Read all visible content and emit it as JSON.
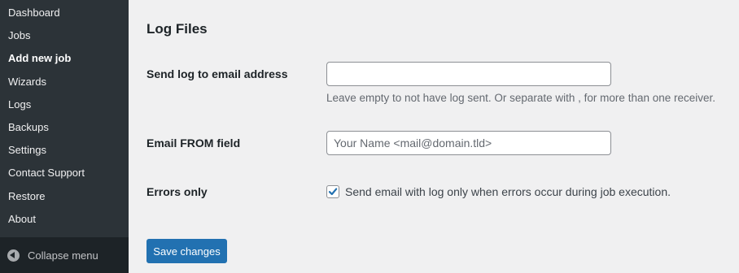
{
  "sidebar": {
    "items": [
      {
        "label": "Dashboard"
      },
      {
        "label": "Jobs"
      },
      {
        "label": "Add new job"
      },
      {
        "label": "Wizards"
      },
      {
        "label": "Logs"
      },
      {
        "label": "Backups"
      },
      {
        "label": "Settings"
      },
      {
        "label": "Contact Support"
      },
      {
        "label": "Restore"
      },
      {
        "label": "About"
      }
    ],
    "current": "Add new job",
    "collapse_label": "Collapse menu"
  },
  "section": {
    "title": "Log Files"
  },
  "fields": {
    "send_log": {
      "label": "Send log to email address",
      "value": "",
      "placeholder": "",
      "description": "Leave empty to not have log sent. Or separate with , for more than one receiver."
    },
    "email_from": {
      "label": "Email FROM field",
      "value": "",
      "placeholder": "Your Name <mail@domain.tld>"
    },
    "errors_only": {
      "label": "Errors only",
      "checked": true,
      "checkbox_label": "Send email with log only when errors occur during job execution."
    }
  },
  "actions": {
    "save_label": "Save changes"
  },
  "colors": {
    "sidebar_bg": "#2c3338",
    "page_bg": "#f0f0f1",
    "accent": "#2271b1"
  }
}
